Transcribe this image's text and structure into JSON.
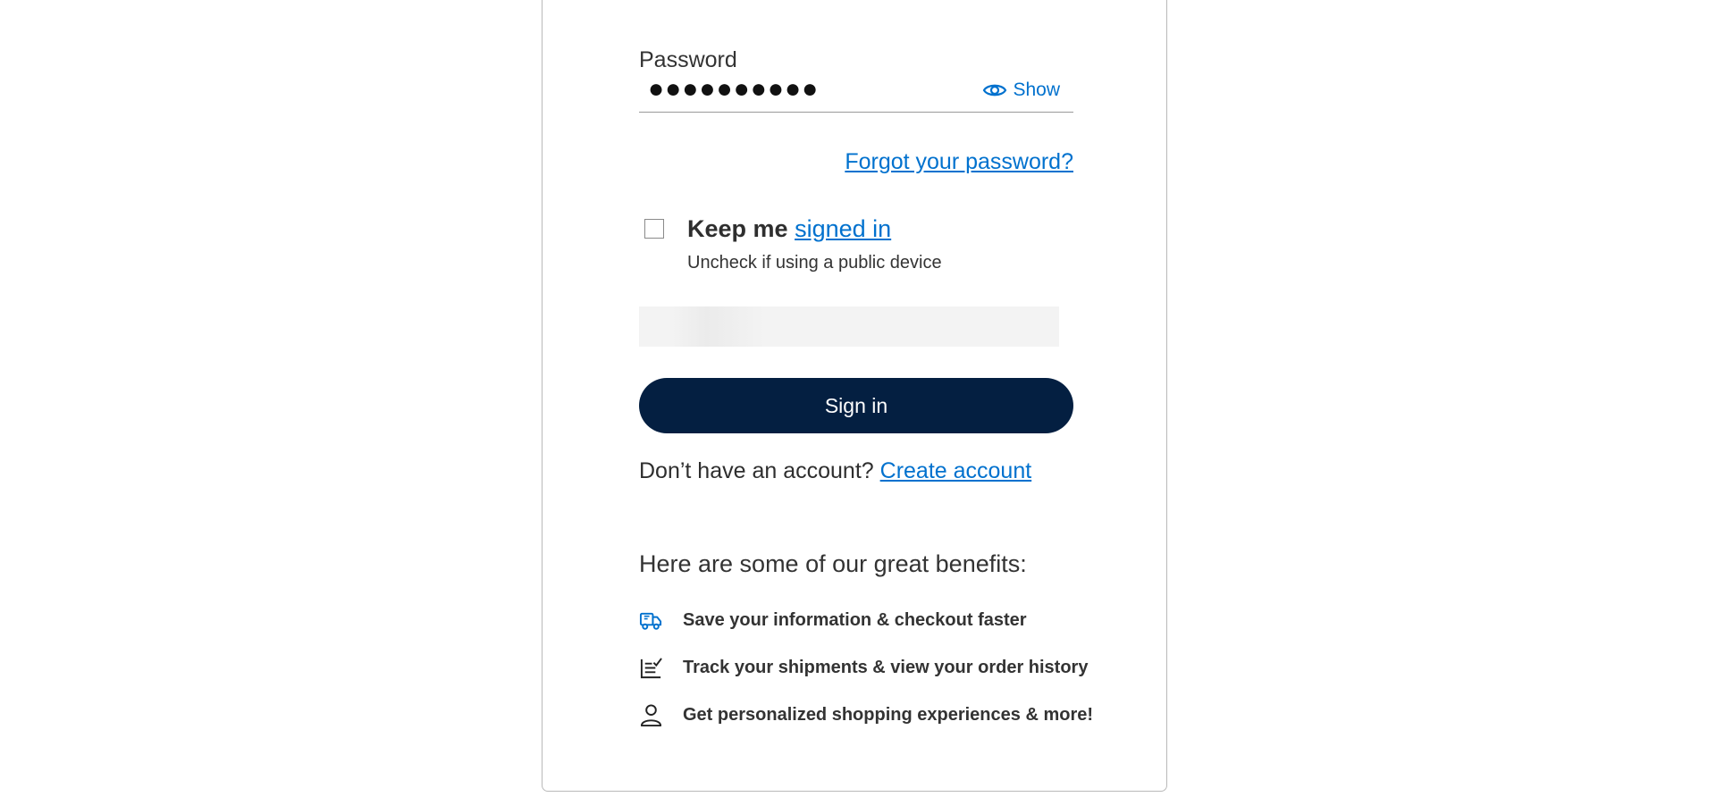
{
  "password": {
    "label": "Password",
    "masked_value": "●●●●●●●●●●",
    "show_label": "Show"
  },
  "forgot_password": "Forgot your password?",
  "keep_signed_in": {
    "label_prefix": "Keep me",
    "label_link": "signed in",
    "sublabel": "Uncheck if using a public device",
    "checked": false
  },
  "signin_button": "Sign in",
  "no_account": {
    "text": "Don’t have an account?",
    "link": "Create account"
  },
  "benefits": {
    "title": "Here are some of our great benefits:",
    "items": [
      {
        "icon": "truck-icon",
        "text": "Save your information & checkout faster"
      },
      {
        "icon": "list-check-icon",
        "text": "Track your shipments & view your order history"
      },
      {
        "icon": "person-icon",
        "text": "Get personalized shopping experiences & more!"
      }
    ]
  },
  "colors": {
    "link": "#0071ce",
    "primary_button": "#041f41"
  }
}
